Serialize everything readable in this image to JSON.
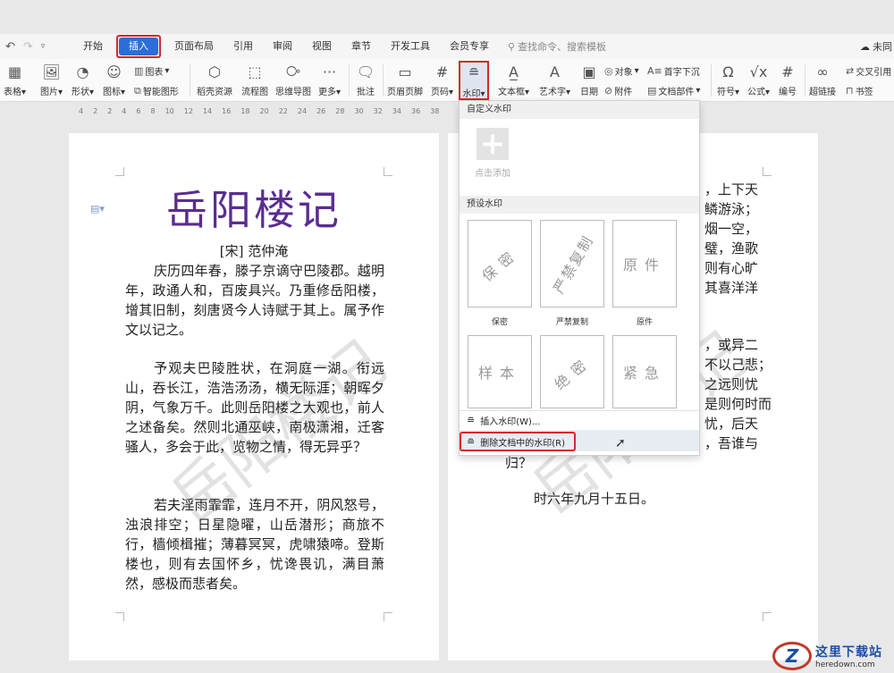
{
  "menubar": {
    "tabs": [
      "开始",
      "插入",
      "页面布局",
      "引用",
      "审阅",
      "视图",
      "章节",
      "开发工具",
      "会员专享"
    ],
    "active_tab": "插入",
    "search_placeholder": "查找命令、搜索模板",
    "cloud_label": "未同"
  },
  "ribbon": {
    "table": "表格",
    "picture": "图片",
    "shape": "形状",
    "icon": "图标",
    "chart": "图表",
    "smart_graphic": "智能图形",
    "shell_resource": "稻壳资源",
    "flowchart": "流程图",
    "mindmap": "思维导图",
    "more": "更多",
    "comment": "批注",
    "header_footer": "页眉页脚",
    "page_number": "页码",
    "watermark": "水印",
    "textbox": "文本框",
    "art_text": "艺术字",
    "date": "日期",
    "object": "对象",
    "attachment": "附件",
    "drop_cap": "首字下沉",
    "doc_parts": "文档部件",
    "symbol": "符号",
    "formula": "公式",
    "numbering": "编号",
    "hyperlink": "超链接",
    "cross_ref": "交叉引用",
    "bookmark": "书签"
  },
  "ruler": [
    "4",
    "2",
    "2",
    "4",
    "6",
    "8",
    "10",
    "12",
    "14",
    "16",
    "18",
    "20",
    "22",
    "24",
    "26",
    "28",
    "30",
    "32",
    "34",
    "36",
    "38"
  ],
  "document": {
    "title": "岳阳楼记",
    "author": "[宋] 范仲淹",
    "paragraphs": [
      "庆历四年春，滕子京谪守巴陵郡。越明年，政通人和，百废具兴。乃重修岳阳楼，增其旧制，刻唐贤今人诗赋于其上。属予作文以记之。",
      "予观夫巴陵胜状，在洞庭一湖。衔远山，吞长江，浩浩汤汤，横无际涯；朝晖夕阴，气象万千。此则岳阳楼之大观也，前人之述备矣。然则北通巫峡，南极潇湘，迁客骚人，多会于此，览物之情，得无异乎？",
      "若夫淫雨霏霏，连月不开，阴风怒号，浊浪排空；日星隐曜，山岳潜形；商旅不行，樯倾楫摧；薄暮冥冥，虎啸猿啼。登斯楼也，则有去国怀乡，忧谗畏讥，满目萧然，感极而悲者矣。"
    ],
    "watermark_text": "岳阳楼记",
    "page2_lines": [
      "，上下天",
      "鳞游泳；",
      "烟一空，",
      "璧，渔歌",
      "则有心旷",
      "其喜洋洋",
      "，或异二",
      "不以己悲；",
      "之远则忧",
      "是则何时而",
      "忧，后天",
      "，吾谁与",
      "归？",
      "时六年九月十五日。"
    ]
  },
  "watermark_panel": {
    "custom_header": "自定义水印",
    "add_label": "点击添加",
    "preset_header": "预设水印",
    "presets": [
      {
        "text": "保密",
        "label": "保密"
      },
      {
        "text": "严禁复制",
        "label": "严禁复制"
      },
      {
        "text": "原件",
        "label": "原件"
      },
      {
        "text": "样本",
        "label": ""
      },
      {
        "text": "绝密",
        "label": ""
      },
      {
        "text": "紧急",
        "label": ""
      }
    ],
    "insert_label": "插入水印(W)...",
    "remove_label": "删除文档中的水印(R)"
  },
  "logo": {
    "letter": "Z",
    "name": "这里下载站",
    "url": "heredown.com"
  }
}
